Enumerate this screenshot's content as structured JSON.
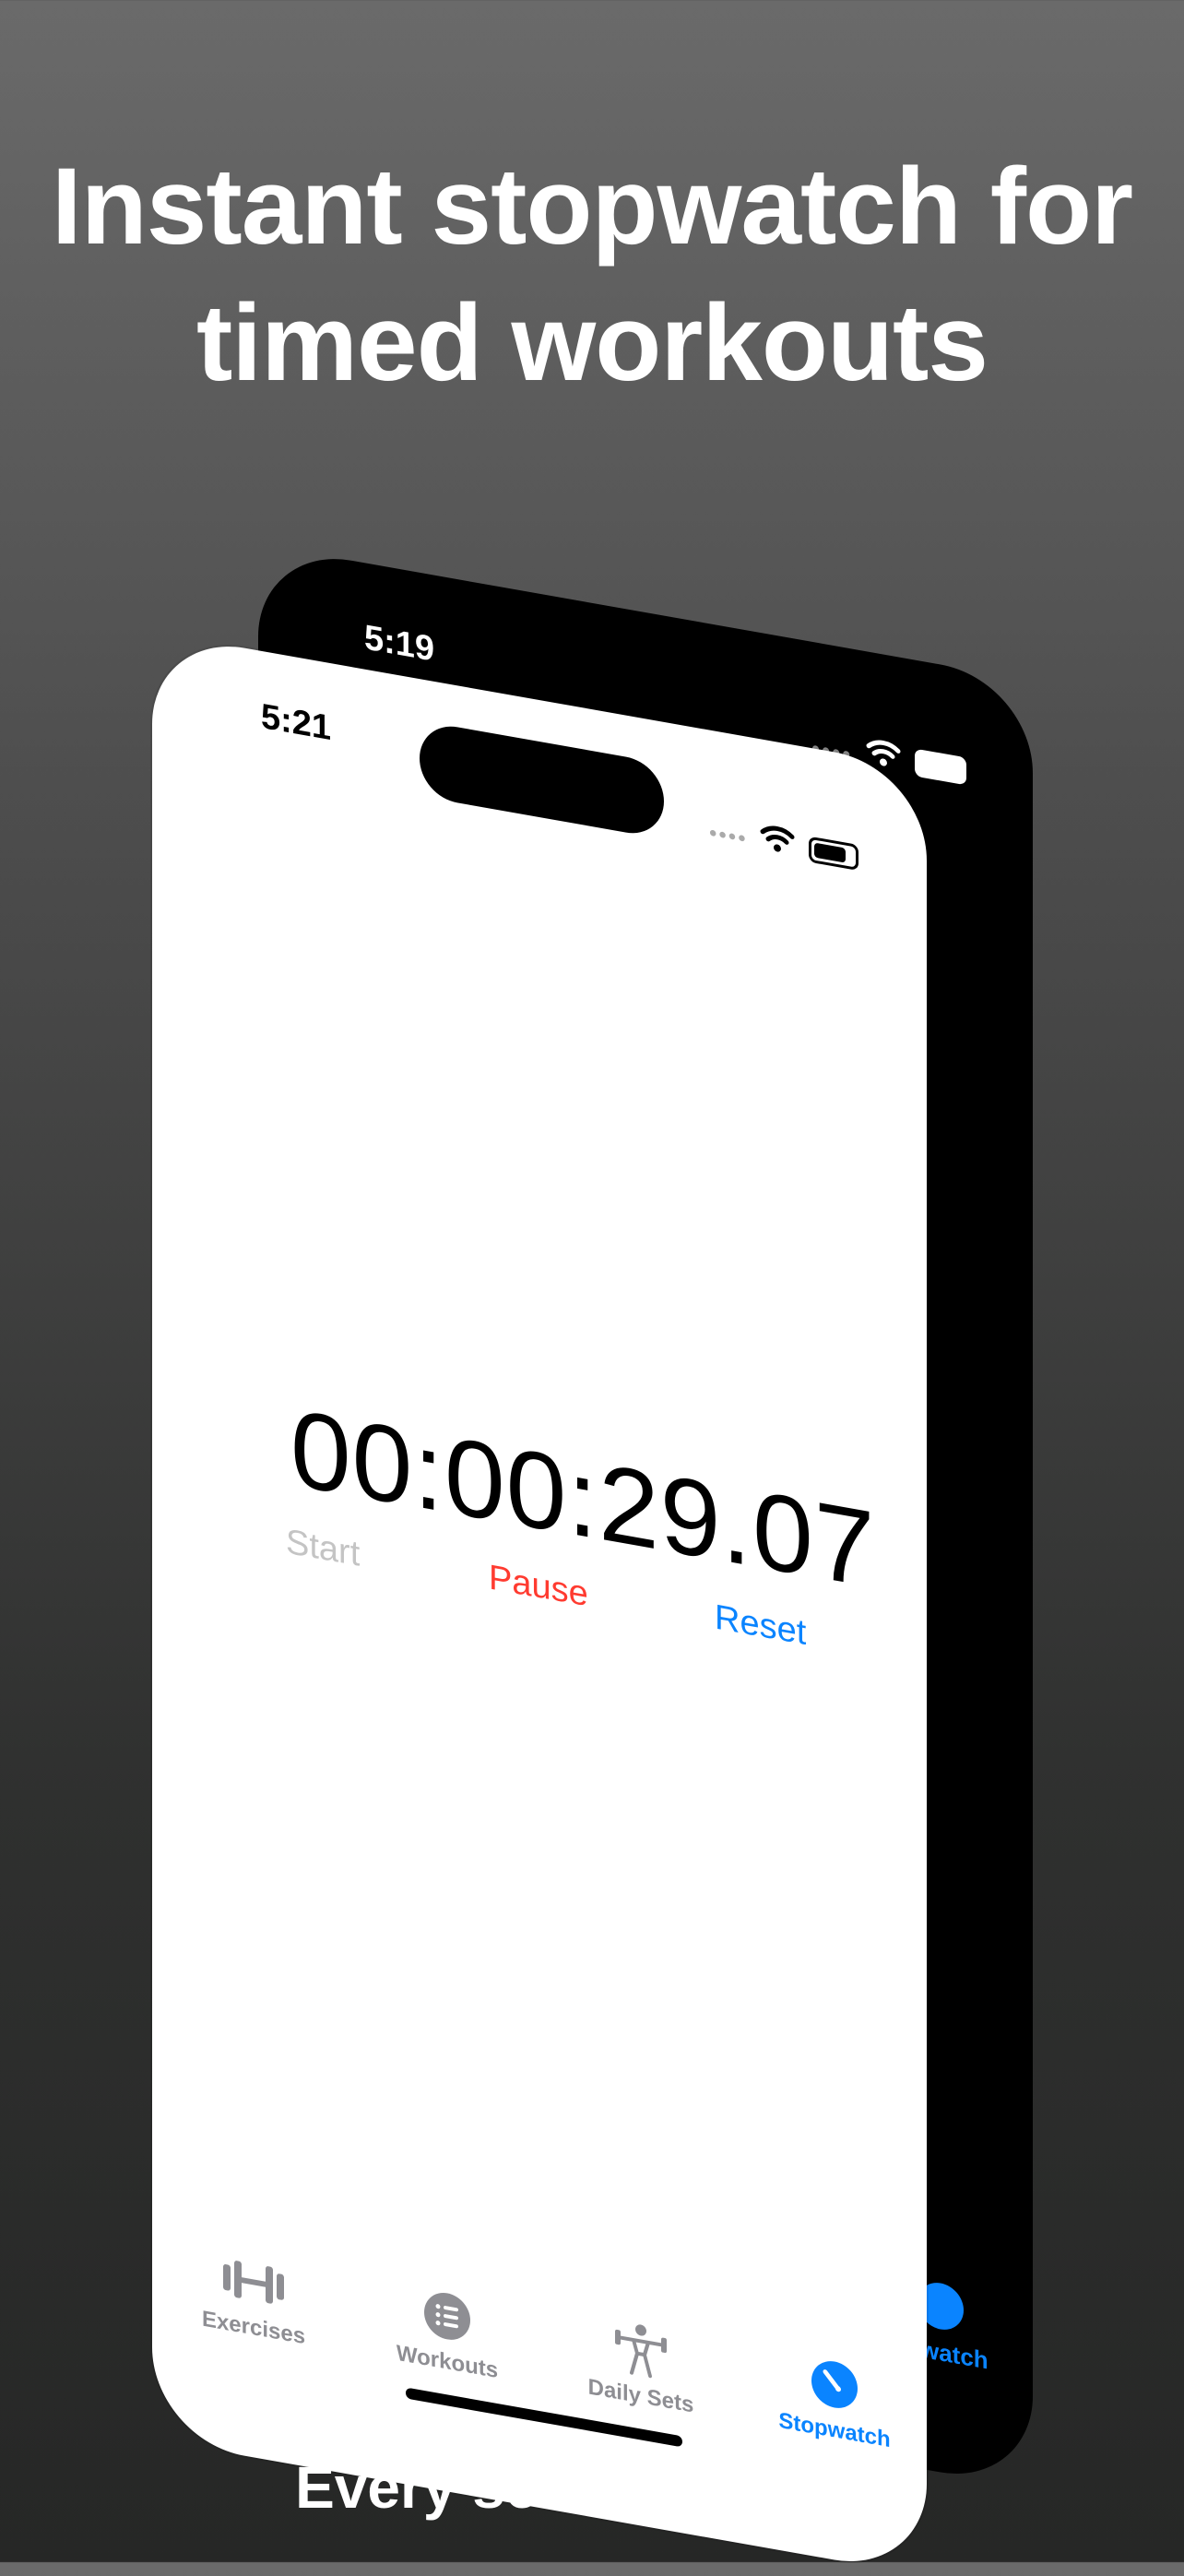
{
  "headline": {
    "line1": "Instant stopwatch for",
    "line2": "timed workouts"
  },
  "footer": "Every second counts",
  "back_phone": {
    "time": "5:19",
    "signal": "••••",
    "tab_label_partial": "watch",
    "accent_color": "#0a84ff"
  },
  "front_phone": {
    "time": "5:21",
    "signal": "••••",
    "stopwatch": {
      "display": "00:00:29.07",
      "start_label": "Start",
      "pause_label": "Pause",
      "reset_label": "Reset"
    },
    "tabs": [
      {
        "label": "Exercises",
        "icon": "dumbbell-icon"
      },
      {
        "label": "Workouts",
        "icon": "list-icon"
      },
      {
        "label": "Daily Sets",
        "icon": "weightlifter-icon"
      },
      {
        "label": "Stopwatch",
        "icon": "stopwatch-icon",
        "active": true
      }
    ]
  },
  "colors": {
    "accent": "#0a84ff",
    "pause": "#ff3b30",
    "disabled": "#c4c4c4",
    "inactive_tab": "#8e8e93"
  }
}
